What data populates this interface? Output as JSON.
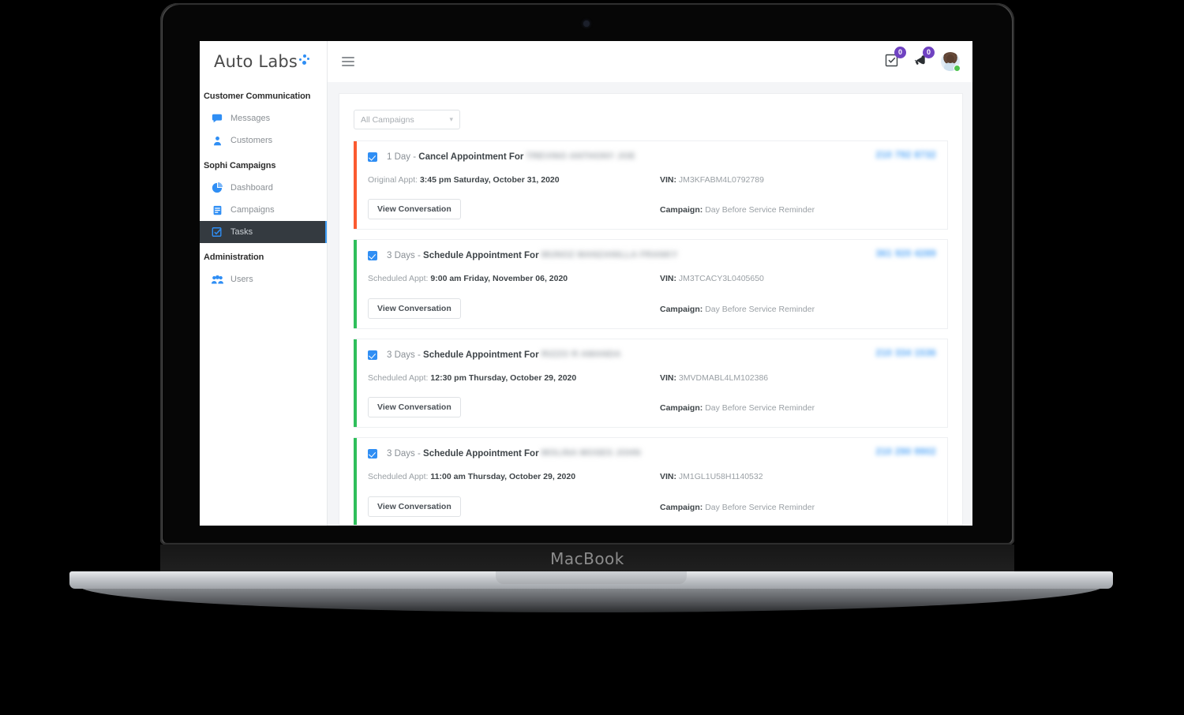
{
  "device": {
    "wordmark": "MacBook"
  },
  "brand": {
    "name": "Auto Labs"
  },
  "sidebar": {
    "sections": [
      {
        "label": "Customer Communication",
        "items": [
          {
            "label": "Messages",
            "icon": "chat-bubble-icon",
            "active": false
          },
          {
            "label": "Customers",
            "icon": "person-icon",
            "active": false
          }
        ]
      },
      {
        "label": "Sophi Campaigns",
        "items": [
          {
            "label": "Dashboard",
            "icon": "pie-chart-icon",
            "active": false
          },
          {
            "label": "Campaigns",
            "icon": "document-icon",
            "active": false
          },
          {
            "label": "Tasks",
            "icon": "checklist-icon",
            "active": true
          }
        ]
      },
      {
        "label": "Administration",
        "items": [
          {
            "label": "Users",
            "icon": "users-icon",
            "active": false
          }
        ]
      }
    ]
  },
  "topbar": {
    "menu_icon": "hamburger-icon",
    "tasks_icon": "task-checkbox-icon",
    "tasks_badge": "0",
    "announcements_icon": "megaphone-icon",
    "announcements_badge": "0",
    "avatar_icon": "user-avatar",
    "status": "online"
  },
  "filter": {
    "selected": "All Campaigns",
    "chevron": "chevron-down-icon"
  },
  "labels": {
    "original_appt": "Original Appt:",
    "scheduled_appt": "Scheduled Appt:",
    "vin": "VIN:",
    "campaign": "Campaign:",
    "view_conversation": "View Conversation"
  },
  "colors": {
    "accent_orange": "#FB5A30",
    "accent_green": "#2FBF5B",
    "checkbox_blue": "#2F8EF4",
    "badge_purple": "#6F42C1",
    "link_blue": "#4DA3F7",
    "active_nav_bg": "#343A40"
  },
  "tasks": [
    {
      "due": "1 Day",
      "action": "Cancel Appointment For",
      "customer_redacted": "TREVINO ANTHONY JOE",
      "phone_redacted": "210 792 8732",
      "appt_label": "Original Appt:",
      "appt_value": "3:45 pm Saturday, October 31, 2020",
      "vin": "JM3KFABM4L0792789",
      "campaign": "Day Before Service Reminder",
      "accent": "#FB5A30",
      "checked": true
    },
    {
      "due": "3 Days",
      "action": "Schedule Appointment For",
      "customer_redacted": "MUNOZ MANZANILLA FRANKY",
      "phone_redacted": "361 920 4289",
      "appt_label": "Scheduled Appt:",
      "appt_value": "9:00 am Friday, November 06, 2020",
      "vin": "JM3TCACY3L0405650",
      "campaign": "Day Before Service Reminder",
      "accent": "#2FBF5B",
      "checked": true
    },
    {
      "due": "3 Days",
      "action": "Schedule Appointment For",
      "customer_redacted": "RIZZO R AMANDA",
      "phone_redacted": "210 334 1536",
      "appt_label": "Scheduled Appt:",
      "appt_value": "12:30 pm Thursday, October 29, 2020",
      "vin": "3MVDMABL4LM102386",
      "campaign": "Day Before Service Reminder",
      "accent": "#2FBF5B",
      "checked": true
    },
    {
      "due": "3 Days",
      "action": "Schedule Appointment For",
      "customer_redacted": "MOLINA MOSES JOHN",
      "phone_redacted": "210 290 9902",
      "appt_label": "Scheduled Appt:",
      "appt_value": "11:00 am Thursday, October 29, 2020",
      "vin": "JM1GL1U58H1140532",
      "campaign": "Day Before Service Reminder",
      "accent": "#2FBF5B",
      "checked": true
    }
  ]
}
